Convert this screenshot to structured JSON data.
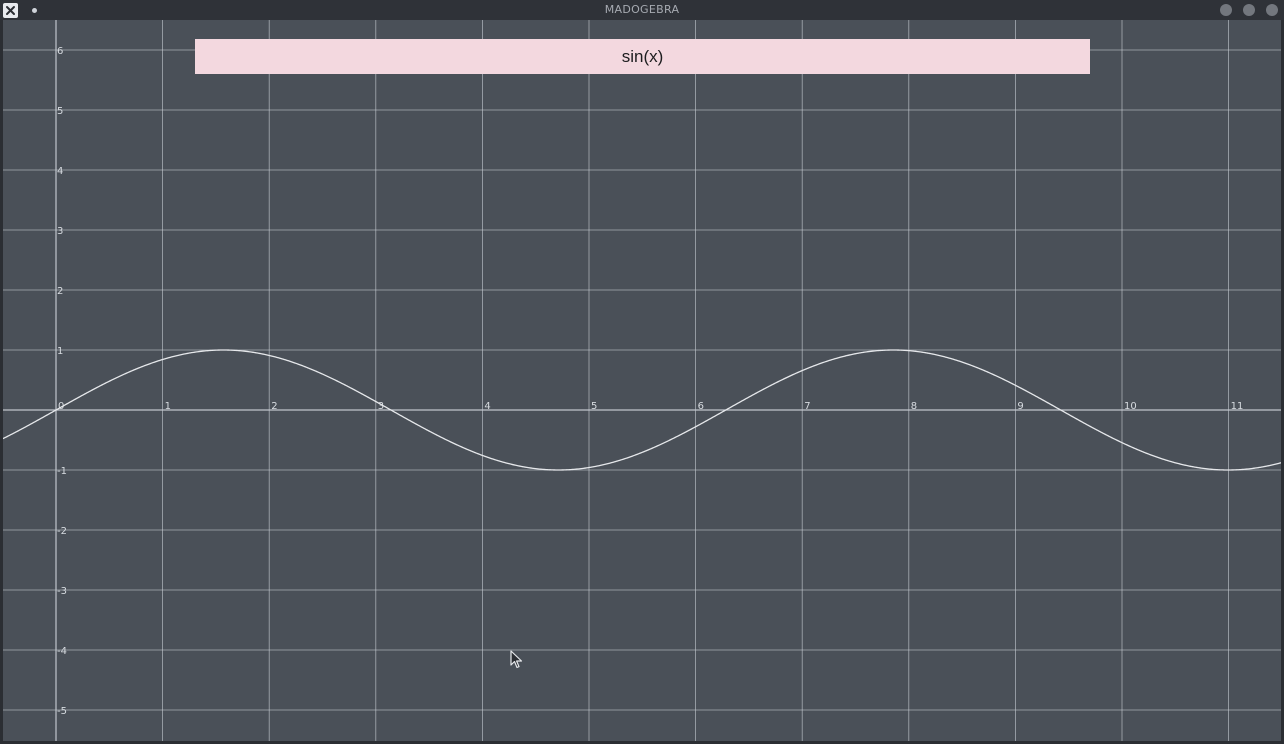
{
  "window": {
    "title": "MADOGEBRA",
    "controls": [
      "close-icon",
      "pin-icon",
      "minimize-icon",
      "maximize-icon",
      "window-close-icon"
    ]
  },
  "function_box": {
    "text": "sin(x)"
  },
  "plot": {
    "function": "sin(x)",
    "x_ticks": [
      "0",
      "1",
      "2",
      "3",
      "4",
      "5",
      "6",
      "7",
      "8",
      "9",
      "10",
      "11"
    ],
    "y_ticks": [
      "6",
      "5",
      "4",
      "3",
      "2",
      "1",
      "-1",
      "-2",
      "-3",
      "-4",
      "-5"
    ],
    "grid": true,
    "colors": {
      "background": "#4a5058",
      "grid": "#c7ccd3",
      "curve": "#e6e8eb",
      "labels": "#d7dbe0"
    }
  },
  "chart_data": {
    "type": "line",
    "series": [
      {
        "name": "sin(x)",
        "function": "sin(x)"
      }
    ],
    "x_range": [
      -0.5,
      11.5
    ],
    "y_range": [
      -5.5,
      6.4
    ],
    "x_ticks": [
      0,
      1,
      2,
      3,
      4,
      5,
      6,
      7,
      8,
      9,
      10,
      11
    ],
    "y_ticks": [
      6,
      5,
      4,
      3,
      2,
      1,
      -1,
      -2,
      -3,
      -4,
      -5
    ],
    "grid": true
  }
}
